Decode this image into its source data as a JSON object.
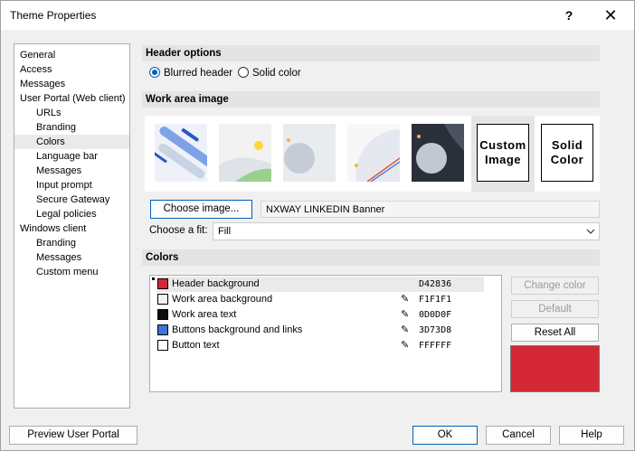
{
  "window": {
    "title": "Theme Properties",
    "help": "?",
    "close": "✕"
  },
  "nav": {
    "items": [
      {
        "label": "General",
        "indent": 0
      },
      {
        "label": "Access",
        "indent": 0
      },
      {
        "label": "Messages",
        "indent": 0
      },
      {
        "label": "User Portal (Web client)",
        "indent": 0
      },
      {
        "label": "URLs",
        "indent": 1
      },
      {
        "label": "Branding",
        "indent": 1
      },
      {
        "label": "Colors",
        "indent": 1,
        "selected": true
      },
      {
        "label": "Language bar",
        "indent": 1
      },
      {
        "label": "Messages",
        "indent": 1
      },
      {
        "label": "Input prompt",
        "indent": 1
      },
      {
        "label": "Secure Gateway",
        "indent": 1
      },
      {
        "label": "Legal policies",
        "indent": 1
      },
      {
        "label": "Windows client",
        "indent": 0
      },
      {
        "label": "Branding",
        "indent": 1
      },
      {
        "label": "Messages",
        "indent": 1
      },
      {
        "label": "Custom menu",
        "indent": 1
      }
    ]
  },
  "header_options": {
    "title": "Header options",
    "blurred_label": "Blurred header",
    "solid_label": "Solid color",
    "selected": "blurred"
  },
  "work_area": {
    "title": "Work area image",
    "custom_image_label": "Custom Image",
    "solid_color_label": "Solid Color",
    "choose_image_label": "Choose image...",
    "image_name": "NXWAY LINKEDIN Banner",
    "fit_label": "Choose a fit:",
    "fit_value": "Fill"
  },
  "colors": {
    "title": "Colors",
    "rows": [
      {
        "name": "Header background",
        "value": "D42836",
        "swatch": "#D42836",
        "editable": false,
        "selected": true
      },
      {
        "name": "Work area background",
        "value": "F1F1F1",
        "swatch": "#F1F1F1",
        "editable": true
      },
      {
        "name": "Work area text",
        "value": "0D0D0F",
        "swatch": "#0D0D0F",
        "editable": true
      },
      {
        "name": "Buttons background and links",
        "value": "3D73D8",
        "swatch": "#3D73D8",
        "editable": true
      },
      {
        "name": "Button text",
        "value": "FFFFFF",
        "swatch": "#FFFFFF",
        "editable": true
      }
    ],
    "change_color_label": "Change color",
    "default_label": "Default",
    "reset_all_label": "Reset All",
    "preview_color": "#D42836"
  },
  "footer": {
    "preview_label": "Preview User Portal",
    "ok_label": "OK",
    "cancel_label": "Cancel",
    "help_label": "Help"
  },
  "accent": "#005fb8"
}
